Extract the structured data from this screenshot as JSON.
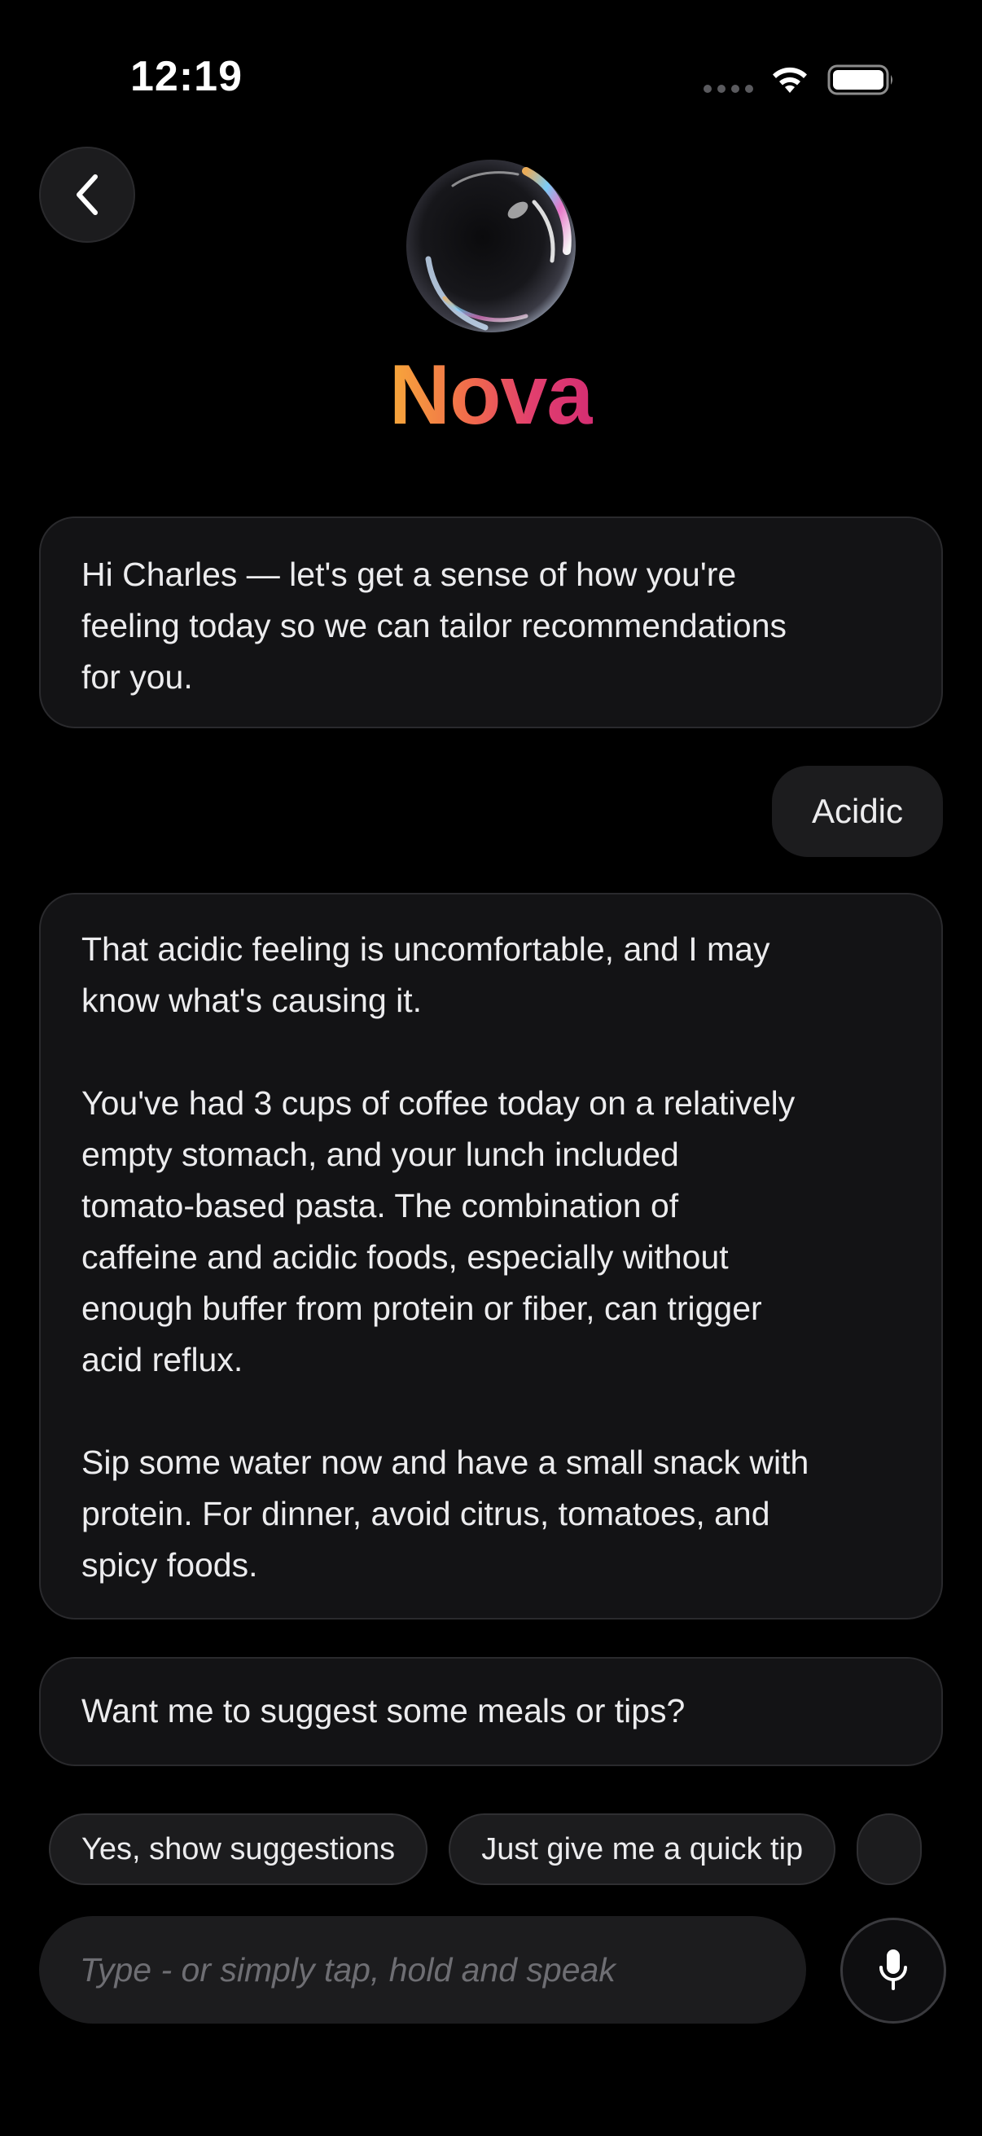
{
  "status_bar": {
    "time": "12:19",
    "icons": [
      "signal-dots-icon",
      "wifi-icon",
      "battery-icon"
    ]
  },
  "header": {
    "back_icon": "chevron-left-icon",
    "avatar_icon": "glass-orb-avatar",
    "assistant_name": "Nova",
    "name_gradient": [
      "#F7A83A",
      "#F06A4C",
      "#E23F6E",
      "#D42E72"
    ]
  },
  "messages": {
    "assistant_greeting": "Hi Charles — let's get a sense of how you're\nfeeling today so we can tailor recommendations\nfor you.",
    "user_reply": "Acidic",
    "assistant_explanation": "That acidic feeling is uncomfortable, and I may\nknow what's causing it.\n\nYou've had 3 cups of coffee today on a relatively\nempty stomach, and your lunch included\ntomato-based pasta. The combination of\ncaffeine and acidic foods, especially without\nenough buffer from protein or fiber, can trigger\nacid reflux.\n\nSip some water now and have a small snack with\nprotein. For dinner, avoid citrus, tomatoes, and\nspicy foods.",
    "assistant_followup": "Want me to suggest some meals or tips?"
  },
  "suggestions": [
    "Yes, show suggestions",
    "Just give me a quick tip"
  ],
  "composer": {
    "placeholder": "Type - or simply tap, hold and speak",
    "value": "",
    "mic_icon": "microphone-icon"
  },
  "colors": {
    "background": "#000000",
    "bubble": "#131315",
    "bubble_border": "#2A2A2D",
    "chip": "#1C1C1E",
    "text": "#ECECEE",
    "placeholder": "#6E6E73"
  }
}
